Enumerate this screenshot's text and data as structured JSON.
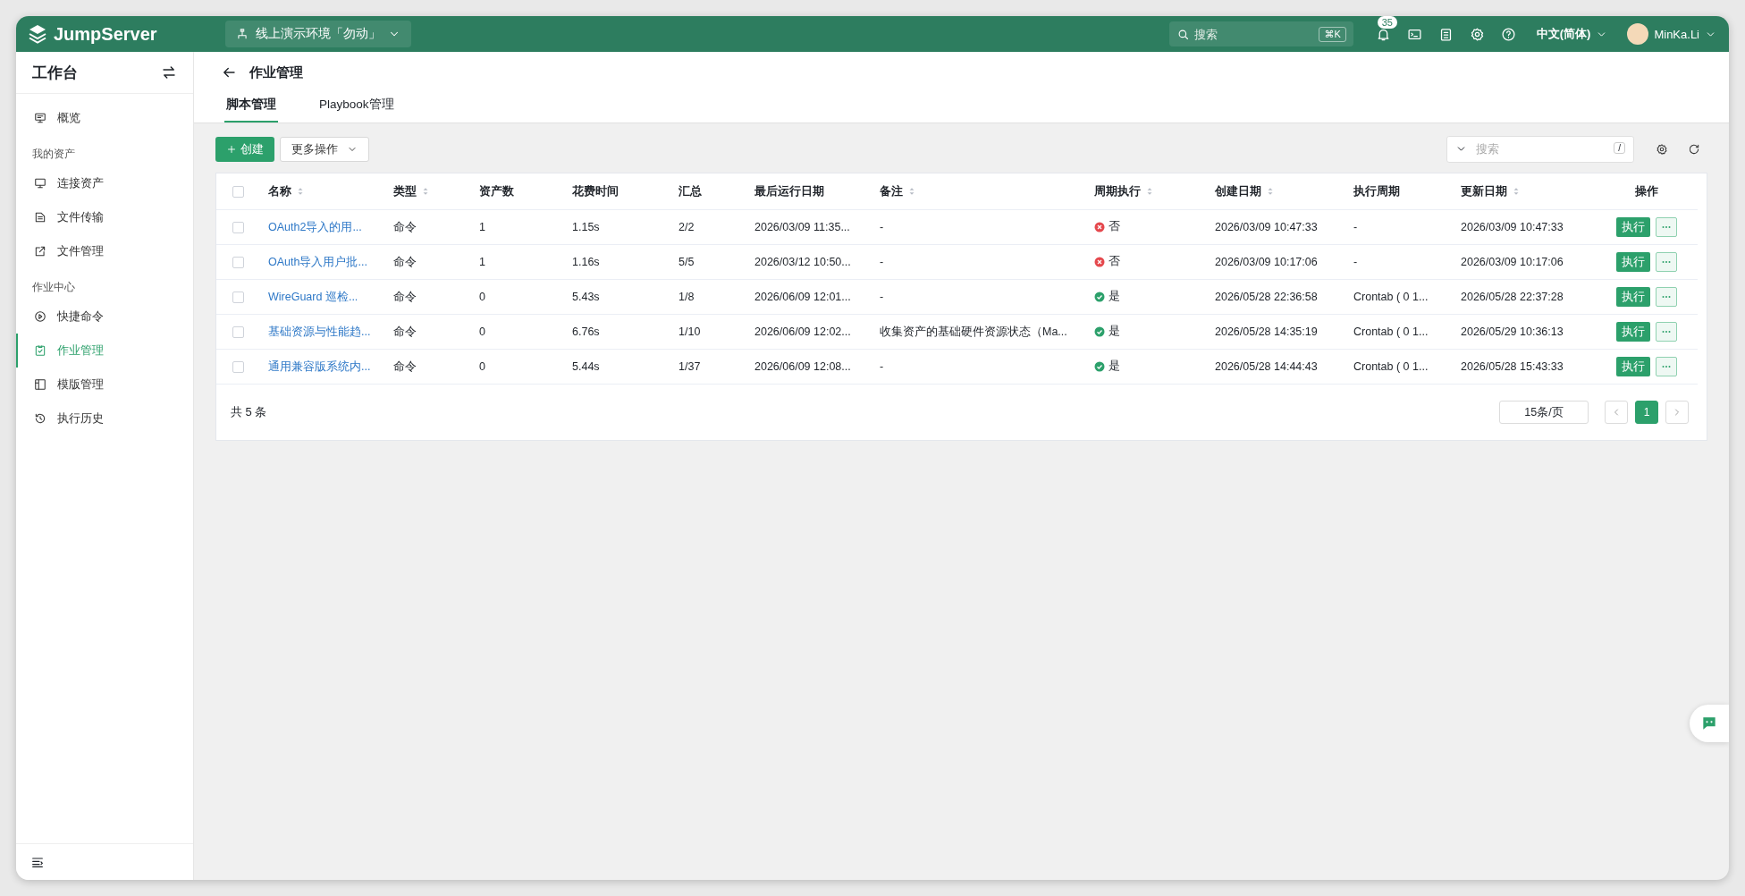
{
  "topbar": {
    "logo": "JumpServer",
    "org": "线上演示环境「勿动」",
    "search": {
      "placeholder": "搜索",
      "shortcut": "⌘K"
    },
    "notifications": "35",
    "language": "中文(简体)",
    "user": "MinKa.Li"
  },
  "sidebar": {
    "title": "工作台",
    "items": [
      {
        "kind": "link",
        "label": "概览",
        "selected": false
      },
      {
        "kind": "section",
        "label": "我的资产"
      },
      {
        "kind": "link",
        "label": "连接资产",
        "selected": false
      },
      {
        "kind": "link",
        "label": "文件传输",
        "selected": false
      },
      {
        "kind": "link",
        "label": "文件管理",
        "selected": false
      },
      {
        "kind": "section",
        "label": "作业中心"
      },
      {
        "kind": "link",
        "label": "快捷命令",
        "selected": false
      },
      {
        "kind": "link",
        "label": "作业管理",
        "selected": true
      },
      {
        "kind": "link",
        "label": "模版管理",
        "selected": false
      },
      {
        "kind": "link",
        "label": "执行历史",
        "selected": false
      }
    ]
  },
  "page": {
    "title": "作业管理",
    "tabs": [
      {
        "label": "脚本管理",
        "selected": true
      },
      {
        "label": "Playbook管理",
        "selected": false
      }
    ]
  },
  "toolbar": {
    "create": "创建",
    "more": "更多操作",
    "search": {
      "placeholder": "搜索",
      "shortcut": "/"
    }
  },
  "table": {
    "select_all": {
      "checked": false
    },
    "columns": [
      {
        "label": "名称",
        "sortable": true
      },
      {
        "label": "类型",
        "sortable": true
      },
      {
        "label": "资产数",
        "sortable": false
      },
      {
        "label": "花费时间",
        "sortable": false
      },
      {
        "label": "汇总",
        "sortable": false
      },
      {
        "label": "最后运行日期",
        "sortable": false
      },
      {
        "label": "备注",
        "sortable": true
      },
      {
        "label": "周期执行",
        "sortable": true
      },
      {
        "label": "创建日期",
        "sortable": true
      },
      {
        "label": "执行周期",
        "sortable": false
      },
      {
        "label": "更新日期",
        "sortable": true
      },
      {
        "label": "操作",
        "sortable": false
      }
    ],
    "rows": [
      {
        "checked": false,
        "name": "OAuth2导入的用...",
        "type": "命令",
        "assets": "1",
        "duration": "1.15s",
        "summary": "2/2",
        "last_run": "2026/03/09 11:35...",
        "remark": "-",
        "periodic": {
          "on": false,
          "label": "否"
        },
        "created": "2026/03/09 10:47:33",
        "period": "-",
        "updated": "2026/03/09 10:47:33",
        "run": "执行"
      },
      {
        "checked": false,
        "name": "OAuth导入用户批...",
        "type": "命令",
        "assets": "1",
        "duration": "1.16s",
        "summary": "5/5",
        "last_run": "2026/03/12 10:50...",
        "remark": "-",
        "periodic": {
          "on": false,
          "label": "否"
        },
        "created": "2026/03/09 10:17:06",
        "period": "-",
        "updated": "2026/03/09 10:17:06",
        "run": "执行"
      },
      {
        "checked": false,
        "name": "WireGuard 巡检...",
        "type": "命令",
        "assets": "0",
        "duration": "5.43s",
        "summary": "1/8",
        "last_run": "2026/06/09 12:01...",
        "remark": "-",
        "periodic": {
          "on": true,
          "label": "是"
        },
        "created": "2026/05/28 22:36:58",
        "period": "Crontab ( 0 1...",
        "updated": "2026/05/28 22:37:28",
        "run": "执行"
      },
      {
        "checked": false,
        "name": "基础资源与性能趋...",
        "type": "命令",
        "assets": "0",
        "duration": "6.76s",
        "summary": "1/10",
        "last_run": "2026/06/09 12:02...",
        "remark": "收集资产的基础硬件资源状态（Ma...",
        "periodic": {
          "on": true,
          "label": "是"
        },
        "created": "2026/05/28 14:35:19",
        "period": "Crontab ( 0 1...",
        "updated": "2026/05/29 10:36:13",
        "run": "执行"
      },
      {
        "checked": false,
        "name": "通用兼容版系统内...",
        "type": "命令",
        "assets": "0",
        "duration": "5.44s",
        "summary": "1/37",
        "last_run": "2026/06/09 12:08...",
        "remark": "-",
        "periodic": {
          "on": true,
          "label": "是"
        },
        "created": "2026/05/28 14:44:43",
        "period": "Crontab ( 0 1...",
        "updated": "2026/05/28 15:43:33",
        "run": "执行"
      }
    ]
  },
  "pager": {
    "total": "共 5 条",
    "page_size": "15条/页",
    "pages": [
      {
        "label": "1",
        "selected": true
      }
    ]
  }
}
